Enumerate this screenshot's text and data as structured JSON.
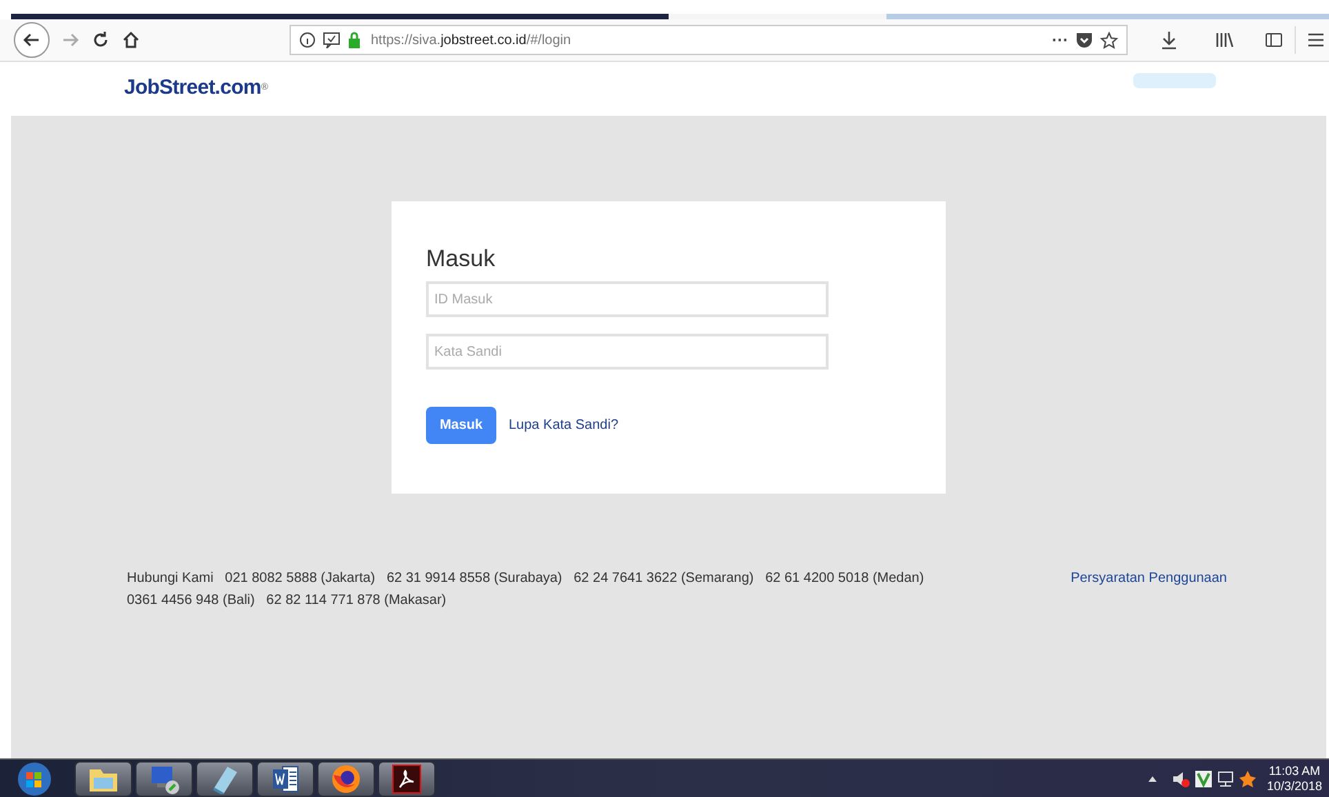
{
  "browser": {
    "url": "https://siva.**jobstreet.co.id**/#/login",
    "more": "···"
  },
  "header": {
    "logo": "JobStreet.com",
    "logo_mark": "®"
  },
  "login": {
    "title": "Masuk",
    "id_field": {
      "placeholder": "ID Masuk"
    },
    "password_field": {
      "placeholder": "Kata Sandi"
    },
    "submit": "Masuk",
    "forgot_link": "Lupa Kata Sandi?"
  },
  "footer": {
    "contacts": [
      "Hubungi Kami   021 8082 5888 (Jakarta)   62 31 9914 8558 (Surabaya)   62 24 7641 3622 (Semarang)   62 61 4200 5018 (Medan)",
      "0361 4456 948 (Bali)   62 82 114 771 878 (Makasar)"
    ],
    "terms_link": "Persyaratan Penggunaan"
  },
  "taskbar": {
    "apps": [
      {
        "kind": "folder"
      },
      {
        "kind": "network"
      },
      {
        "kind": "notepad"
      },
      {
        "kind": "word"
      },
      {
        "kind": "firefox"
      },
      {
        "kind": "pdf"
      }
    ],
    "time": "11:03 AM",
    "date": "10/3/2018"
  }
}
